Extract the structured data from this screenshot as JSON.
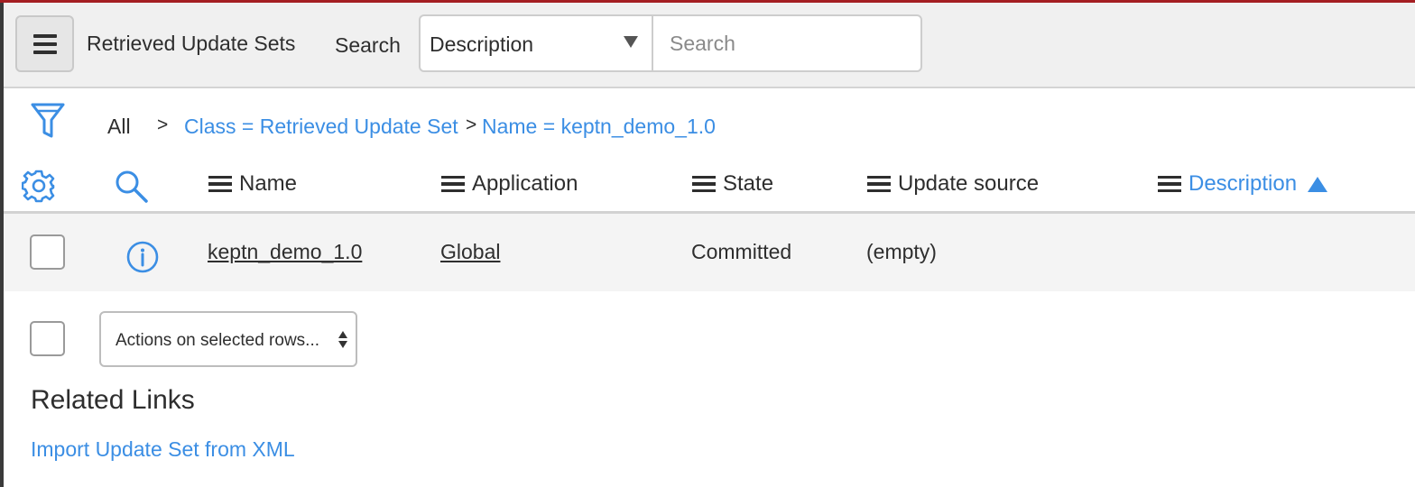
{
  "header": {
    "list_title": "Retrieved Update Sets",
    "search_label": "Search",
    "search_field": "Description",
    "search_placeholder": "Search"
  },
  "breadcrumb": {
    "all": "All",
    "separator": ">",
    "filters": [
      "Class = Retrieved Update Set",
      "Name = keptn_demo_1.0"
    ]
  },
  "columns": [
    {
      "label": "Name",
      "sorted": false
    },
    {
      "label": "Application",
      "sorted": false
    },
    {
      "label": "State",
      "sorted": false
    },
    {
      "label": "Update source",
      "sorted": false
    },
    {
      "label": "Description",
      "sorted": true,
      "sort_direction": "ascending"
    }
  ],
  "rows": [
    {
      "name": "keptn_demo_1.0",
      "application": "Global",
      "state": "Committed",
      "update_source": "(empty)",
      "description": ""
    }
  ],
  "actions": {
    "select_label": "Actions on selected rows..."
  },
  "related_links": {
    "title": "Related Links",
    "items": [
      "Import Update Set from XML"
    ]
  },
  "colors": {
    "accent_link": "#3b8ee4",
    "top_bar": "#a41e22",
    "header_bg": "#f0f0f0",
    "row_bg": "#f4f4f4"
  },
  "icons": [
    "menu-icon",
    "filter-icon",
    "gear-icon",
    "magnify-icon",
    "info-icon",
    "column-menu-icon",
    "sort-ascending-icon"
  ]
}
